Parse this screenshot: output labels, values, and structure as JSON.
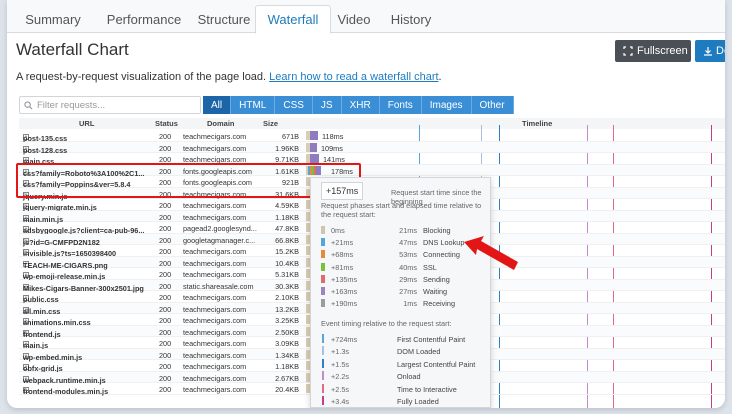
{
  "tabs": [
    {
      "label": "Summary",
      "active": false
    },
    {
      "label": "Performance",
      "active": false
    },
    {
      "label": "Structure",
      "active": false
    },
    {
      "label": "Waterfall",
      "active": true
    },
    {
      "label": "Video",
      "active": false
    },
    {
      "label": "History",
      "active": false
    }
  ],
  "header": {
    "title": "Waterfall Chart",
    "fullscreen_label": "Fullscreen",
    "download_label": "Do",
    "description": "A request-by-request visualization of the page load.",
    "link_text": "Learn how to read a waterfall chart",
    "link_suffix": "."
  },
  "filter": {
    "placeholder": "Filter requests...",
    "chips": [
      "All",
      "HTML",
      "CSS",
      "JS",
      "XHR",
      "Fonts",
      "Images",
      "Other"
    ],
    "active_chip": "All"
  },
  "columns": {
    "url": "URL",
    "status": "Status",
    "domain": "Domain",
    "size": "Size",
    "timeline": "Timeline"
  },
  "rows": [
    {
      "url": "post-135.css",
      "status": "200",
      "domain": "teachmecigars.com",
      "size": "671B",
      "time": "118ms"
    },
    {
      "url": "post-128.css",
      "status": "200",
      "domain": "teachmecigars.com",
      "size": "1.96KB",
      "time": "109ms"
    },
    {
      "url": "main.css",
      "status": "200",
      "domain": "teachmecigars.com",
      "size": "9.71KB",
      "time": "141ms"
    },
    {
      "url": "css?family=Roboto%3A100%2C1...",
      "status": "200",
      "domain": "fonts.googleapis.com",
      "size": "1.61KB",
      "time": "178ms"
    },
    {
      "url": "css?family=Poppins&ver=5.8.4",
      "status": "200",
      "domain": "fonts.googleapis.com",
      "size": "921B",
      "time": ""
    },
    {
      "url": "jquery.min.js",
      "status": "200",
      "domain": "teachmecigars.com",
      "size": "31.6KB",
      "time": ""
    },
    {
      "url": "jquery-migrate.min.js",
      "status": "200",
      "domain": "teachmecigars.com",
      "size": "4.59KB",
      "time": ""
    },
    {
      "url": "main.min.js",
      "status": "200",
      "domain": "teachmecigars.com",
      "size": "1.18KB",
      "time": ""
    },
    {
      "url": "adsbygoogle.js?client=ca-pub-96...",
      "status": "200",
      "domain": "pagead2.googlesynd...",
      "size": "47.8KB",
      "time": ""
    },
    {
      "url": "js?id=G-CMFPD2N182",
      "status": "200",
      "domain": "googletagmanager.c...",
      "size": "66.8KB",
      "time": ""
    },
    {
      "url": "invisible.js?ts=1650398400",
      "status": "200",
      "domain": "teachmecigars.com",
      "size": "15.2KB",
      "time": ""
    },
    {
      "url": "TEACH-ME-CIGARS.png",
      "status": "200",
      "domain": "teachmecigars.com",
      "size": "10.4KB",
      "time": ""
    },
    {
      "url": "wp-emoji-release.min.js",
      "status": "200",
      "domain": "teachmecigars.com",
      "size": "5.31KB",
      "time": ""
    },
    {
      "url": "Mikes-Cigars-Banner-300x2501.jpg",
      "status": "200",
      "domain": "static.shareasale.com",
      "size": "30.3KB",
      "time": ""
    },
    {
      "url": "public.css",
      "status": "200",
      "domain": "teachmecigars.com",
      "size": "2.10KB",
      "time": ""
    },
    {
      "url": "all.min.css",
      "status": "200",
      "domain": "teachmecigars.com",
      "size": "13.2KB",
      "time": ""
    },
    {
      "url": "animations.min.css",
      "status": "200",
      "domain": "teachmecigars.com",
      "size": "3.25KB",
      "time": ""
    },
    {
      "url": "frontend.js",
      "status": "200",
      "domain": "teachmecigars.com",
      "size": "2.50KB",
      "time": ""
    },
    {
      "url": "main.js",
      "status": "200",
      "domain": "teachmecigars.com",
      "size": "3.09KB",
      "time": ""
    },
    {
      "url": "wp-embed.min.js",
      "status": "200",
      "domain": "teachmecigars.com",
      "size": "1.34KB",
      "time": ""
    },
    {
      "url": "obfx-grid.js",
      "status": "200",
      "domain": "teachmecigars.com",
      "size": "1.18KB",
      "time": ""
    },
    {
      "url": "webpack.runtime.min.js",
      "status": "200",
      "domain": "teachmecigars.com",
      "size": "2.67KB",
      "time": ""
    },
    {
      "url": "frontend-modules.min.js",
      "status": "200",
      "domain": "teachmecigars.com",
      "size": "20.4KB",
      "time": ""
    }
  ],
  "popup": {
    "start": "+157ms",
    "start_caption": "Request start time since the beginning",
    "phases_caption": "Request phases start and elapsed time relative to the request start:",
    "phases": [
      {
        "start": "0ms",
        "duration": "21ms",
        "name": "Blocking",
        "color": "#cfc4ae"
      },
      {
        "start": "+21ms",
        "duration": "47ms",
        "name": "DNS Lookup",
        "color": "#57a6d9"
      },
      {
        "start": "+68ms",
        "duration": "53ms",
        "name": "Connecting",
        "color": "#e38d3a"
      },
      {
        "start": "+81ms",
        "duration": "40ms",
        "name": "SSL",
        "color": "#7bbf3c"
      },
      {
        "start": "+135ms",
        "duration": "29ms",
        "name": "Sending",
        "color": "#d86e6e"
      },
      {
        "start": "+163ms",
        "duration": "27ms",
        "name": "Waiting",
        "color": "#9a84c4"
      },
      {
        "start": "+190ms",
        "duration": "1ms",
        "name": "Receiving",
        "color": "#9c9c9c"
      }
    ],
    "events_caption": "Event timing relative to the request start:",
    "events": [
      {
        "time": "+724ms",
        "name": "First Contentful Paint",
        "color": "#57a6d9"
      },
      {
        "time": "+1.3s",
        "name": "DOM Loaded",
        "color": "#a8bfe0"
      },
      {
        "time": "+1.5s",
        "name": "Largest Contentful Paint",
        "color": "#2f7fc8"
      },
      {
        "time": "+2.2s",
        "name": "Onload",
        "color": "#c48ad0"
      },
      {
        "time": "+2.5s",
        "name": "Time to Interactive",
        "color": "#e36a8a"
      },
      {
        "time": "+3.4s",
        "name": "Fully Loaded",
        "color": "#c83a8a"
      }
    ]
  },
  "colors": {
    "accent": "#1f7bbf",
    "highlight": "#e31616",
    "blocking": "#d9cdb4",
    "waiting": "#8e7cc3"
  }
}
